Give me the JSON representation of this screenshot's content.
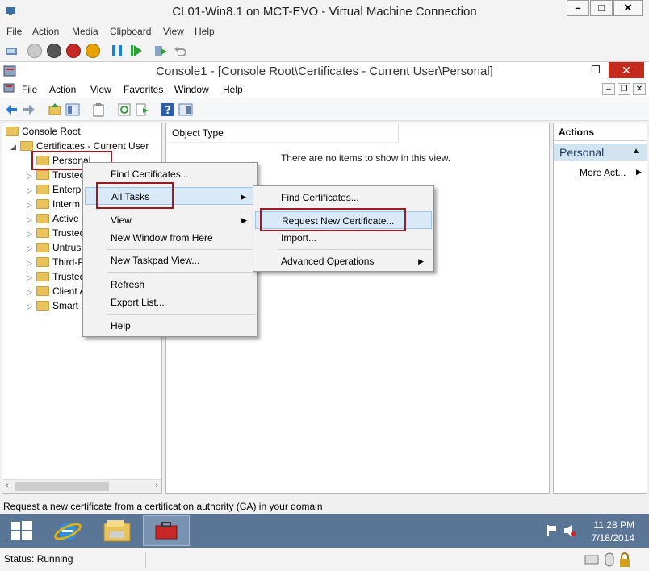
{
  "vm_window": {
    "title": "CL01-Win8.1 on MCT-EVO - Virtual Machine Connection",
    "menu": [
      "File",
      "Action",
      "Media",
      "Clipboard",
      "View",
      "Help"
    ],
    "controls": {
      "minimize": "–",
      "maximize": "□",
      "close": "✕"
    },
    "status": "Status: Running"
  },
  "mmc_window": {
    "title": "Console1 - [Console Root\\Certificates - Current User\\Personal]",
    "menu": [
      "File",
      "Action",
      "View",
      "Favorites",
      "Window",
      "Help"
    ],
    "close_glyph": "✕",
    "max_glyph": "❐"
  },
  "tree": {
    "root": "Console Root",
    "store": "Certificates - Current User",
    "items": [
      "Personal",
      "Trusted",
      "Enterp",
      "Interm",
      "Active",
      "Trusted",
      "Untrus",
      "Third-P",
      "Trusted",
      "Client A",
      "Smart C"
    ]
  },
  "list_pane": {
    "column": "Object Type",
    "empty_message": "There are no items to show in this view."
  },
  "actions_pane": {
    "header": "Actions",
    "section": "Personal",
    "item": "More Act..."
  },
  "context_menu": {
    "items": [
      "Find Certificates...",
      "All Tasks",
      "View",
      "New Window from Here",
      "New Taskpad View...",
      "Refresh",
      "Export List...",
      "Help"
    ]
  },
  "submenu": {
    "items": [
      "Find Certificates...",
      "Request New Certificate...",
      "Import...",
      "Advanced Operations"
    ]
  },
  "status_line": "Request a new certificate from a certification authority (CA) in your domain",
  "taskbar": {
    "time": "11:28 PM",
    "date": "7/18/2014"
  },
  "colors": {
    "taskbar": "#5b7596",
    "highlight_box": "#9b1b22",
    "actions_section_bg": "#d3e4f1",
    "close_red": "#c42b1c"
  }
}
